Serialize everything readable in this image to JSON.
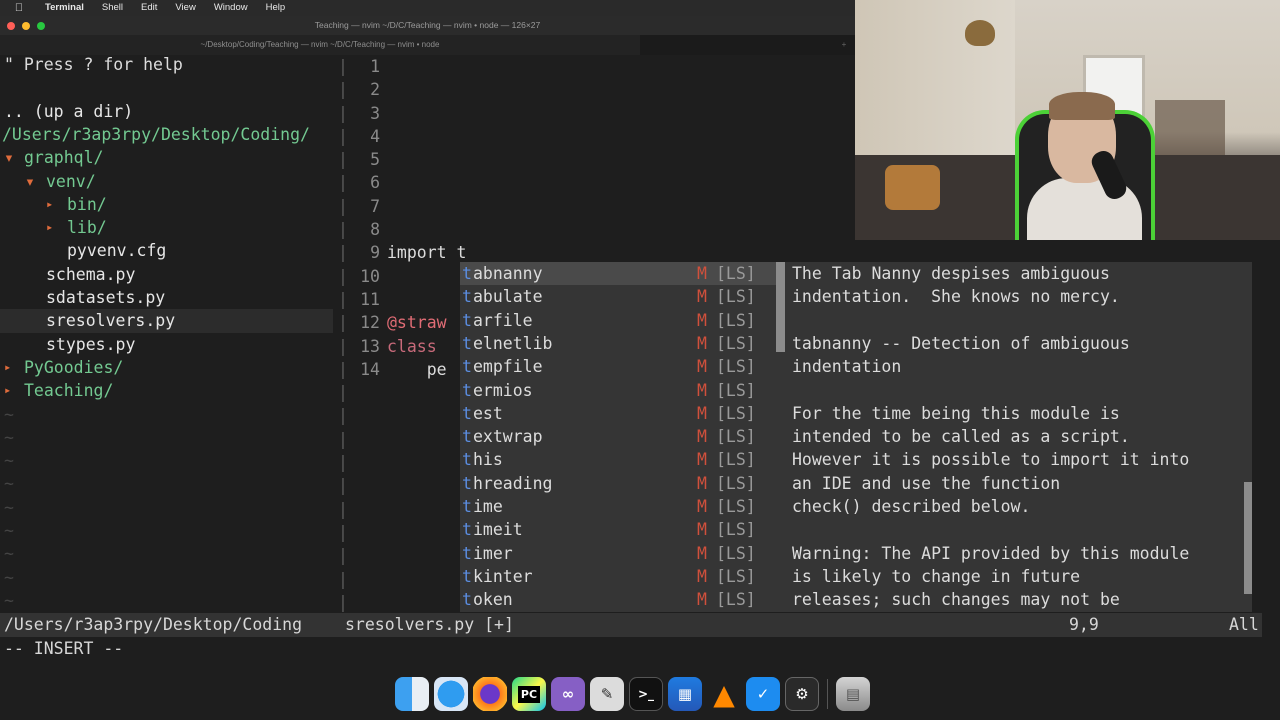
{
  "menubar": {
    "apple": "",
    "items": [
      "Terminal",
      "Shell",
      "Edit",
      "View",
      "Window",
      "Help"
    ]
  },
  "window": {
    "title": "Teaching — nvim ~/D/C/Teaching — nvim • node — 126×27",
    "tab_title": "~/Desktop/Coding/Teaching — nvim ~/D/C/Teaching — nvim • node",
    "tab_new": "+"
  },
  "tree": {
    "help": "\" Press ? for help",
    "up": ".. (up a dir)",
    "root": "/Users/r3ap3rpy/Desktop/Coding/",
    "graphql": "graphql/",
    "venv": "venv/",
    "bin": "bin/",
    "lib": "lib/",
    "pyvenv": "pyvenv.cfg",
    "schema": "schema.py",
    "sdatasets": "sdatasets.py",
    "sresolvers": "sresolvers.py",
    "stypes": "stypes.py",
    "pygoodies": "PyGoodies/",
    "teaching": "Teaching/",
    "arrow_open": "▾",
    "arrow_closed": "▸",
    "tilde": "~"
  },
  "code": {
    "line_numbers": [
      "1",
      "2",
      "3",
      "4",
      "5",
      "6",
      "7",
      "8",
      "9",
      "10",
      "11",
      "12",
      "13",
      "14"
    ],
    "line9": "import t",
    "line12": "@straw",
    "line13": "class ",
    "line14": "    pe"
  },
  "completion": {
    "kind": "M",
    "source": "[LS]",
    "prefix": "t",
    "items": [
      "abnanny",
      "abulate",
      "arfile",
      "elnetlib",
      "empfile",
      "ermios",
      "est",
      "extwrap",
      "his",
      "hreading",
      "ime",
      "imeit",
      "imer",
      "kinter",
      "oken"
    ]
  },
  "doc": {
    "lines": [
      "The Tab Nanny despises ambiguous",
      "indentation.  She knows no mercy.",
      "",
      "tabnanny -- Detection of ambiguous",
      "indentation",
      "",
      "For the time being this module is",
      "intended to be called as a script.",
      "However it is possible to import it into",
      "an IDE and use the function",
      "check() described below.",
      "",
      "Warning: The API provided by this module",
      "is likely to change in future",
      "releases; such changes may not be"
    ]
  },
  "status": {
    "left": "/Users/r3ap3rpy/Desktop/Coding",
    "file": "sresolvers.py [+]",
    "pos": "9,9",
    "scroll": "All"
  },
  "mode": "-- INSERT --",
  "dock": {
    "icons": [
      "finder-icon",
      "safari-icon",
      "firefox-icon",
      "pycharm-icon",
      "visual-studio-icon",
      "script-editor-icon",
      "terminal-icon",
      "app-store-connect-icon",
      "vlc-icon",
      "checkmark-app-icon",
      "activity-icon",
      "trash-icon"
    ],
    "terminal_glyph": ">_",
    "pycharm_glyph": "PC"
  },
  "colors": {
    "directory": "#73c991",
    "arrow": "#e06c3c",
    "kind": "#d0503c",
    "popup_bg": "#353535",
    "status_bg": "#333333"
  }
}
